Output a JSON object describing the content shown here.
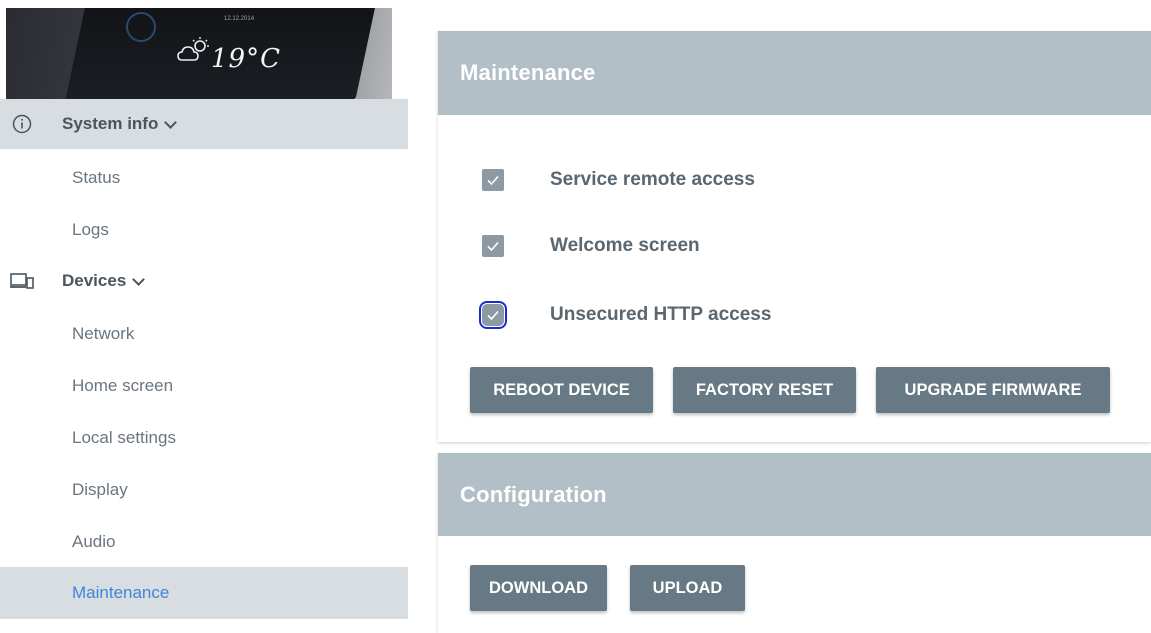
{
  "hero": {
    "temperature": "19°C",
    "date": "12.12.2014",
    "weather_icon": "cloud-sun-icon"
  },
  "sidebar": {
    "system_info": {
      "label": "System info",
      "icon": "info-icon"
    },
    "system_items": [
      {
        "label": "Status"
      },
      {
        "label": "Logs"
      }
    ],
    "devices": {
      "label": "Devices",
      "icon": "devices-icon"
    },
    "device_items": [
      {
        "label": "Network"
      },
      {
        "label": "Home screen"
      },
      {
        "label": "Local settings"
      },
      {
        "label": "Display"
      },
      {
        "label": "Audio"
      },
      {
        "label": "Maintenance"
      }
    ],
    "selected": "Maintenance"
  },
  "maintenance": {
    "title": "Maintenance",
    "options": [
      {
        "label": "Service remote access",
        "checked": true
      },
      {
        "label": "Welcome screen",
        "checked": true
      },
      {
        "label": "Unsecured HTTP access",
        "checked": true
      }
    ],
    "buttons": {
      "reboot": "REBOOT DEVICE",
      "factory_reset": "FACTORY RESET",
      "upgrade": "UPGRADE FIRMWARE"
    }
  },
  "configuration": {
    "title": "Configuration",
    "buttons": {
      "download": "DOWNLOAD",
      "upload": "UPLOAD"
    }
  },
  "colors": {
    "card_header": "#b3bfc6",
    "button": "#667985",
    "checkbox": "#8d9aa3",
    "selected_text": "#3f86d8",
    "selected_bg": "#d8dde1"
  }
}
